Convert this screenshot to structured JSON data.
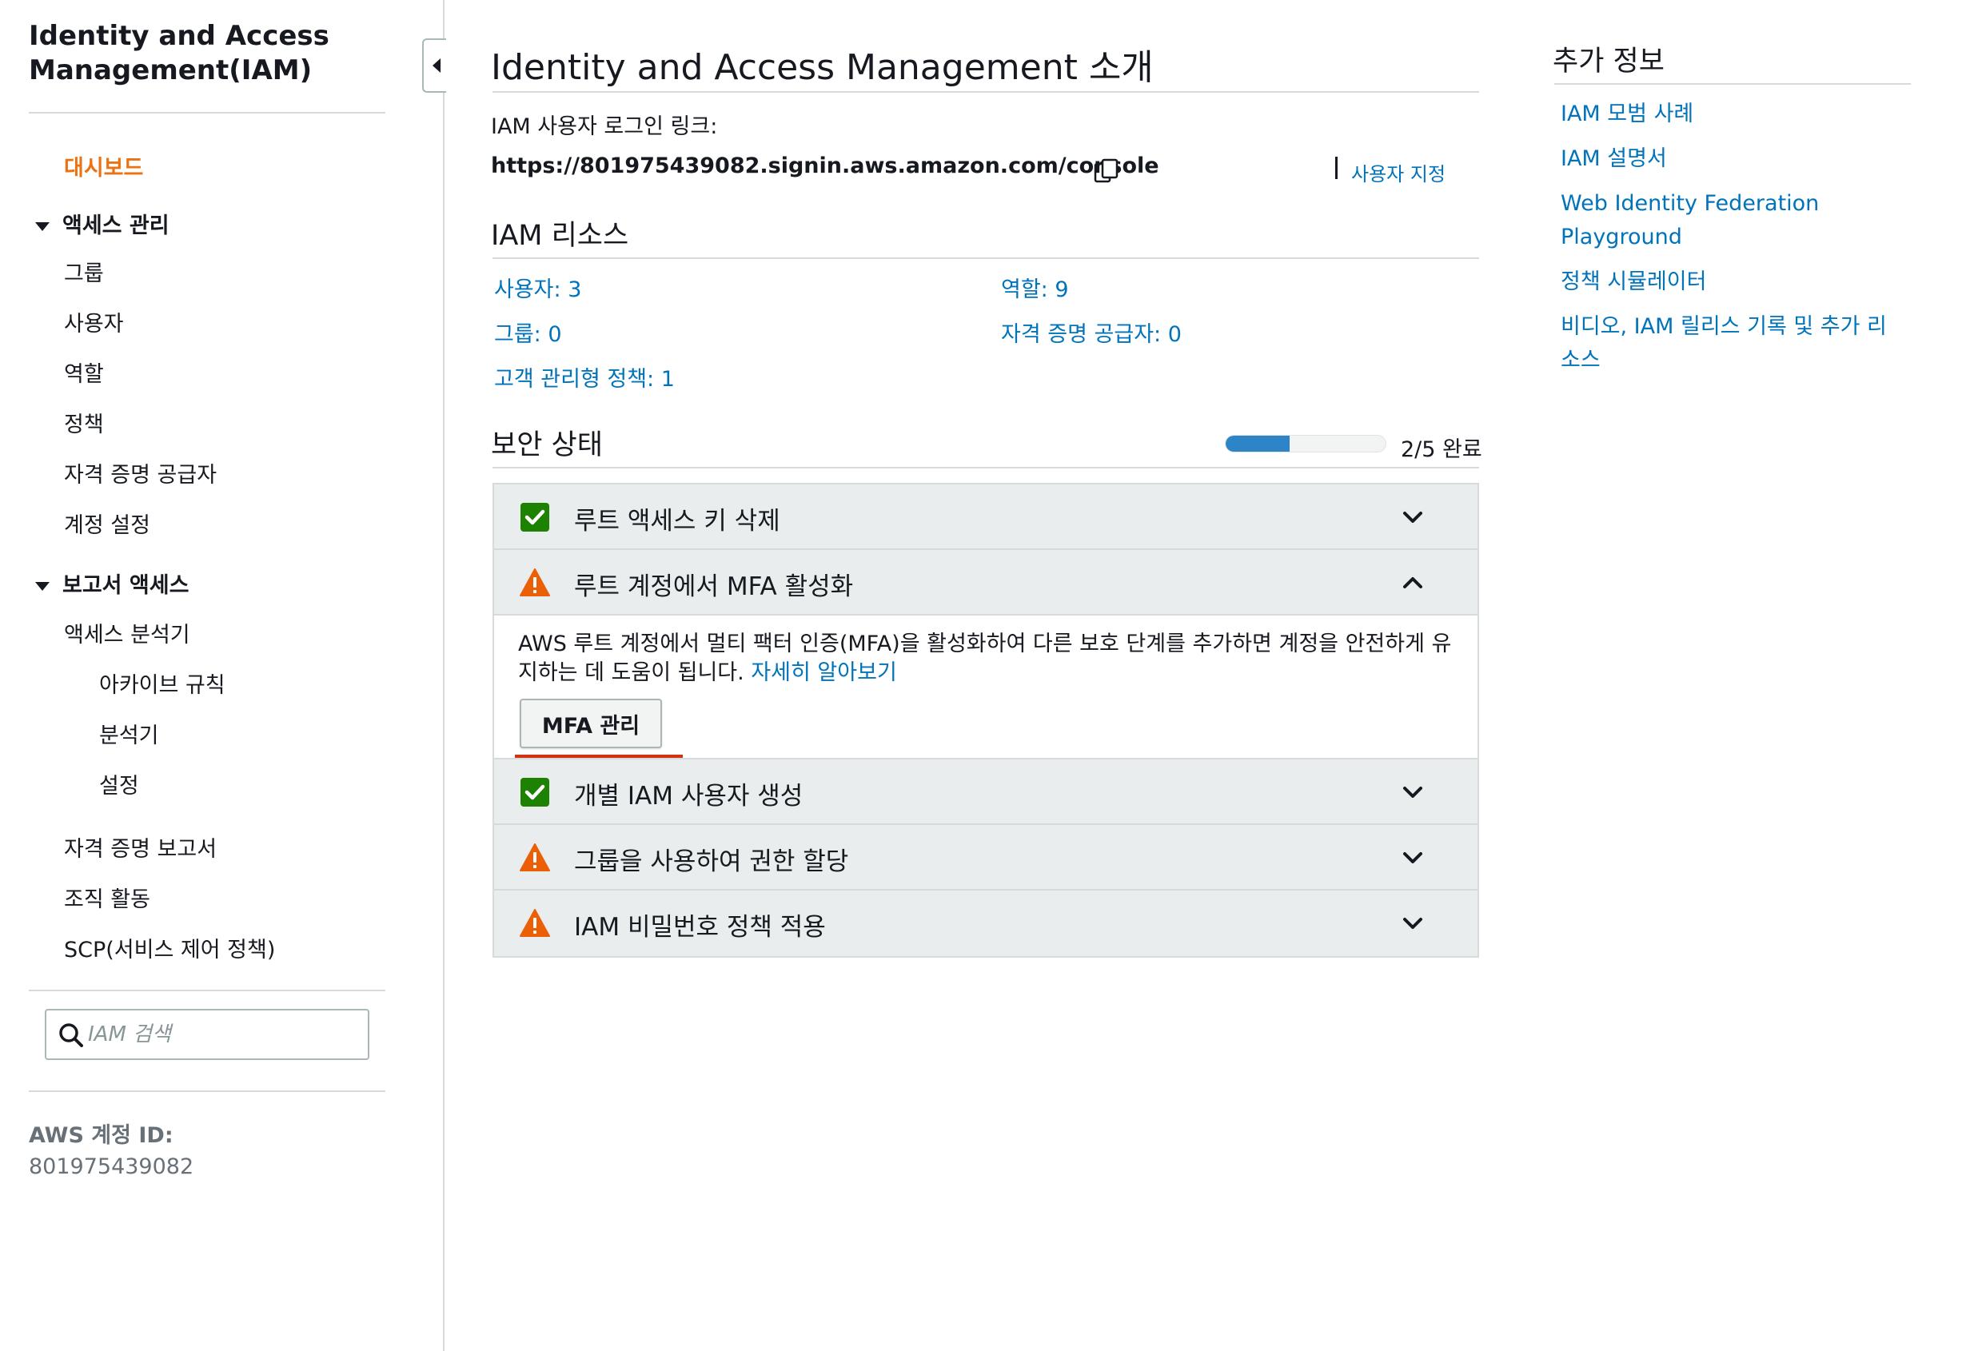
{
  "sidebar": {
    "title": "Identity and Access Management(IAM)",
    "dashboard": "대시보드",
    "access_management": {
      "label": "액세스 관리",
      "items": [
        "그룹",
        "사용자",
        "역할",
        "정책",
        "자격 증명 공급자",
        "계정 설정"
      ]
    },
    "report_access": {
      "label": "보고서 액세스",
      "analyzer": "액세스 분석기",
      "analyzer_items": [
        "아카이브 규칙",
        "분석기",
        "설정"
      ],
      "items": [
        "자격 증명 보고서",
        "조직 활동",
        "SCP(서비스 제어 정책)"
      ]
    },
    "search": {
      "placeholder": "IAM 검색",
      "icon": "search-icon"
    },
    "account": {
      "label": "AWS 계정 ID:",
      "value": "801975439082"
    }
  },
  "main": {
    "title": "Identity and Access Management 소개",
    "signin_label": "IAM 사용자 로그인 링크:",
    "signin_url": "https://801975439082.signin.aws.amazon.com/console",
    "customize": "사용자 지정",
    "resources": {
      "title": "IAM 리소스",
      "users": "사용자: 3",
      "roles": "역할: 9",
      "groups": "그룹: 0",
      "identity_providers": "자격 증명 공급자: 0",
      "customer_policies": "고객 관리형 정책: 1"
    },
    "security": {
      "title": "보안 상태",
      "progress_text": "2/5 완료",
      "progress_fraction": 0.4,
      "items": [
        {
          "label": "루트 액세스 키 삭제",
          "status": "ok",
          "expanded": false
        },
        {
          "label": "루트 계정에서 MFA 활성화",
          "status": "warning",
          "expanded": true
        },
        {
          "label": "개별 IAM 사용자 생성",
          "status": "ok",
          "expanded": false
        },
        {
          "label": "그룹을 사용하여 권한 할당",
          "status": "warning",
          "expanded": false
        },
        {
          "label": "IAM 비밀번호 정책 적용",
          "status": "warning",
          "expanded": false
        }
      ],
      "mfa_description": "AWS 루트 계정에서 멀티 팩터 인증(MFA)을 활성화하여 다른 보호 단계를 추가하면 계정을 안전하게 유지하는 데 도움이 됩니다.",
      "learn_more": "자세히 알아보기",
      "mfa_button": "MFA 관리"
    }
  },
  "right": {
    "title": "추가 정보",
    "links": [
      "IAM 모범 사례",
      "IAM 설명서",
      "Web Identity Federation Playground",
      "정책 시뮬레이터",
      "비디오, IAM 릴리스 기록 및 추가 리소스"
    ]
  },
  "colors": {
    "link": "#0073bb",
    "active": "#ec7211",
    "ok": "#1d8102",
    "warning": "#eb5f07",
    "progress": "#2d84c6",
    "highlight": "#d13212"
  }
}
